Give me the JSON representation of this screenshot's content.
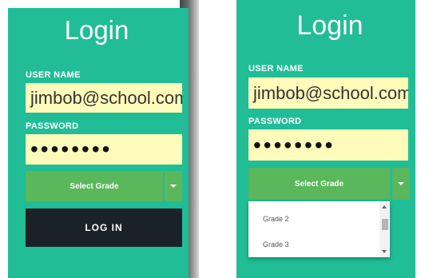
{
  "left": {
    "title": "Login",
    "username_label": "USER NAME",
    "username_value": "jimbob@school.com",
    "password_label": "PASSWORD",
    "password_value": "••••••••",
    "grade_select_label": "Select Grade",
    "login_button": "LOG IN"
  },
  "right": {
    "title": "Login",
    "username_label": "USER NAME",
    "username_value": "jimbob@school.com",
    "password_label": "PASSWORD",
    "password_value": "••••••••",
    "grade_select_label": "Select Grade",
    "dropdown_options": [
      "Grade 2",
      "Grade 3"
    ]
  },
  "colors": {
    "panel_bg": "#20bd96",
    "input_bg": "#fffbba",
    "select_bg": "#5bb75b",
    "button_bg": "#1b2128"
  },
  "icons": {
    "select_caret": "chevron-down-icon",
    "scroll_up": "arrow-up-icon",
    "scroll_down": "arrow-down-icon"
  }
}
